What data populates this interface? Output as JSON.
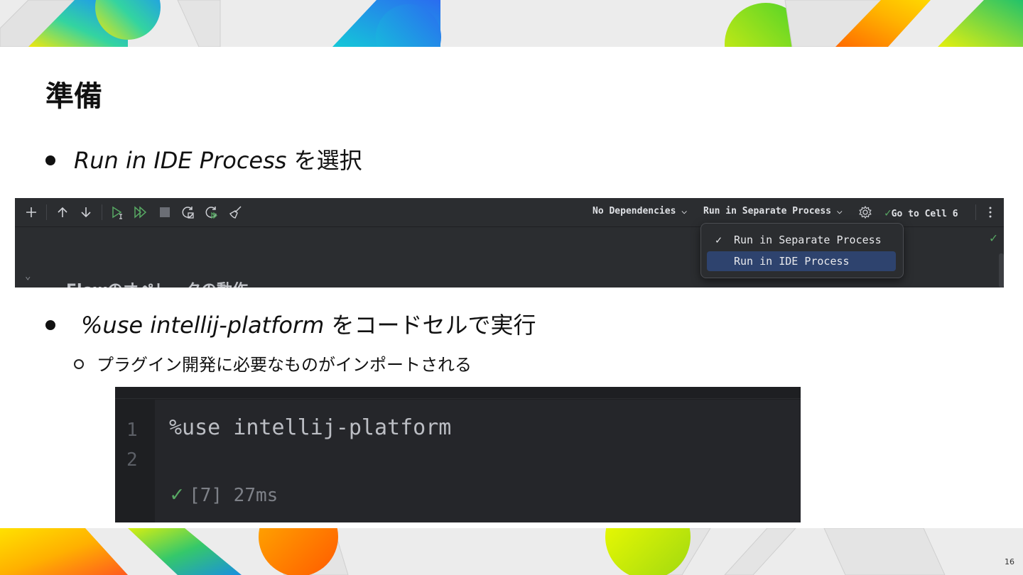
{
  "slide": {
    "title": "準備",
    "page_number": "16"
  },
  "bullets": [
    {
      "italic": "Run in IDE Process",
      "rest": " を選択"
    },
    {
      "italic": "%use intellij-platform",
      "rest": " をコードセルで実行"
    }
  ],
  "sub_bullet": "プラグイン開発に必要なものがインポートされる",
  "ide": {
    "toolbar": {
      "dependencies_label": "No Dependencies",
      "run_mode_label": "Run in Separate Process",
      "goto_cell_label": "Go to Cell 6"
    },
    "run_menu": {
      "items": [
        {
          "label": "Run in Separate Process",
          "checked": true
        },
        {
          "label": "Run in IDE Process",
          "selected": true
        }
      ]
    },
    "cell_heading": "Flowのオペレータの動作"
  },
  "code_cell": {
    "line_numbers": [
      "1",
      "2"
    ],
    "code": "%use intellij-platform",
    "status": "[7] 27ms"
  },
  "colors": {
    "ide_bg": "#2b2d30",
    "menu_selected": "#2e436e",
    "run_green": "#57a863"
  },
  "icons": [
    "add-icon",
    "arrow-up-icon",
    "arrow-down-icon",
    "run-cell-icon",
    "run-all-icon",
    "stop-icon",
    "restart-icon",
    "restart-run-icon",
    "clear-outputs-icon",
    "chevron-down-icon",
    "settings-icon",
    "check-icon",
    "more-vertical-icon",
    "collapse-chevron-icon"
  ]
}
